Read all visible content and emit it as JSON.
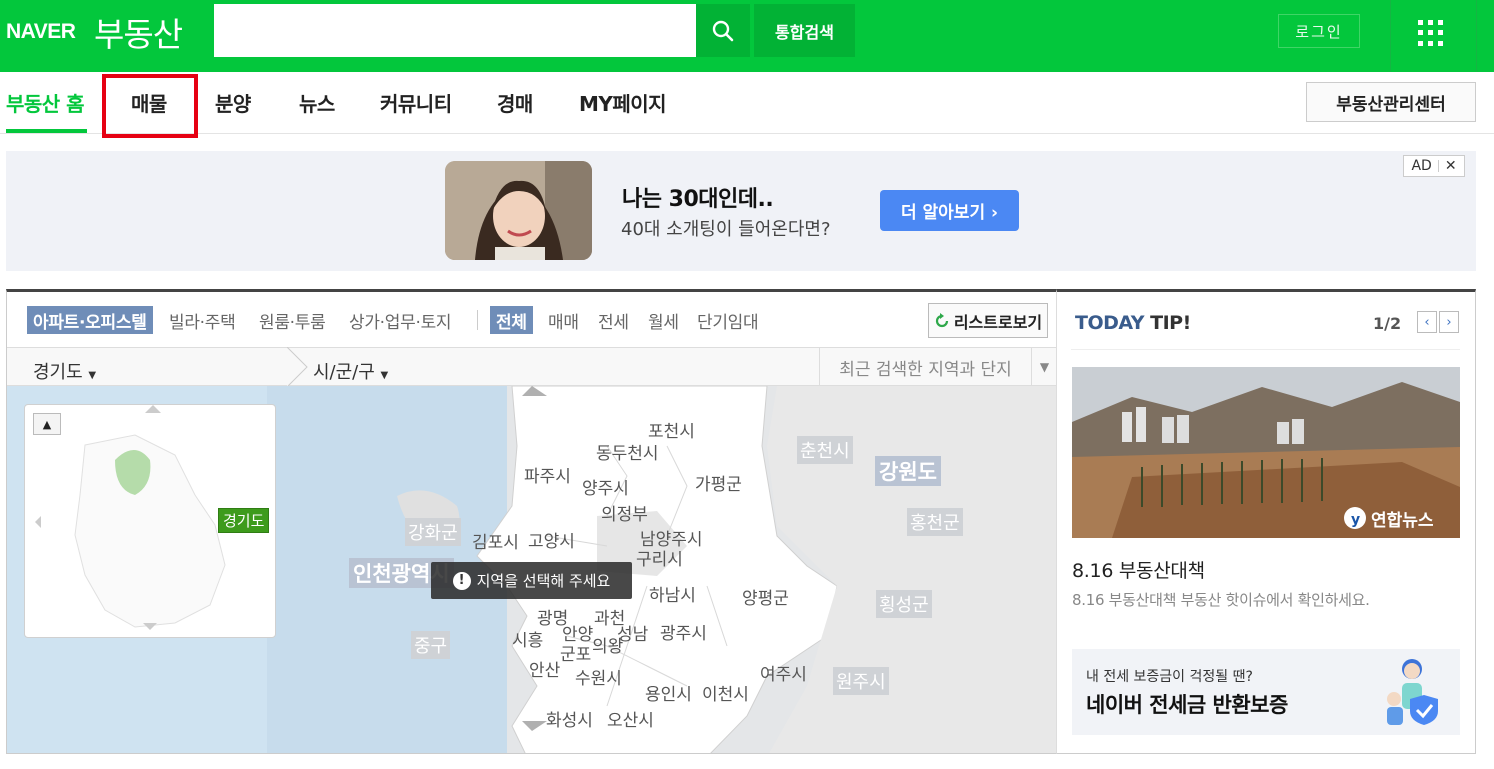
{
  "header": {
    "brand": "NAVER",
    "service": "부동산",
    "search_placeholder": "",
    "total_search": "통합검색",
    "login": "로그인"
  },
  "nav": {
    "items": [
      "부동산 홈",
      "매물",
      "분양",
      "뉴스",
      "커뮤니티",
      "경매",
      "MY페이지"
    ],
    "active": "부동산 홈",
    "management": "부동산관리센터"
  },
  "ad": {
    "title": "나는 30대인데..",
    "subtitle": "40대 소개팅이 들어온다면?",
    "cta": "더 알아보기 ›",
    "tag": "AD"
  },
  "map_panel": {
    "property_types": [
      "아파트·오피스텔",
      "빌라·주택",
      "원룸·투룸",
      "상가·업무·토지"
    ],
    "trade_types": [
      "전체",
      "매매",
      "전세",
      "월세",
      "단기임대"
    ],
    "list_view": "리스트로보기",
    "province": "경기도",
    "city": "시/군/구",
    "recent_search": "최근 검색한 지역과 단지",
    "minimap_label": "경기도",
    "tooltip": "지역을 선택해 주세요",
    "regions": {
      "pocheon": "포천시",
      "dongducheon": "동두천시",
      "paju": "파주시",
      "yangju": "양주시",
      "gapyeong": "가평군",
      "uijeongbu": "의정부",
      "gimpo": "김포시",
      "goyang": "고양시",
      "namyangju": "남양주시",
      "guri": "구리시",
      "hanam": "하남시",
      "yangpyeong": "양평군",
      "gwangmyeong": "광명",
      "gwacheon": "과천",
      "siheung": "시흥",
      "anyang": "안양",
      "seongnam": "성남",
      "gunpo": "군포",
      "uiwang": "의왕",
      "gwangju": "광주시",
      "ansan": "안산",
      "suwon": "수원시",
      "yeoju": "여주시",
      "yongin": "용인시",
      "icheon": "이천시",
      "hwaseong": "화성시",
      "osan": "오산시",
      "chuncheon": "춘천시",
      "gangwon": "강원도",
      "hongcheon": "홍천군",
      "hoengseong": "횡성군",
      "wonju": "원주시",
      "ganghwa": "강화군",
      "incheon": "인천광역시",
      "junggu": "중구"
    }
  },
  "today_tip": {
    "label_a": "TODAY",
    "label_b": "TIP!",
    "page": "1/2",
    "image_watermark": "연합뉴스",
    "title": "8.16 부동산대책",
    "desc": "8.16 부동산대책 부동산 핫이슈에서 확인하세요.",
    "banner_sub": "내 전세 보증금이 걱정될 땐?",
    "banner_title": "네이버 전세금 반환보증"
  },
  "colors": {
    "brand_green": "#03c73c",
    "highlight_red": "#e60012",
    "filter_selected": "#6f8db8",
    "ad_cta": "#4b88f3"
  }
}
